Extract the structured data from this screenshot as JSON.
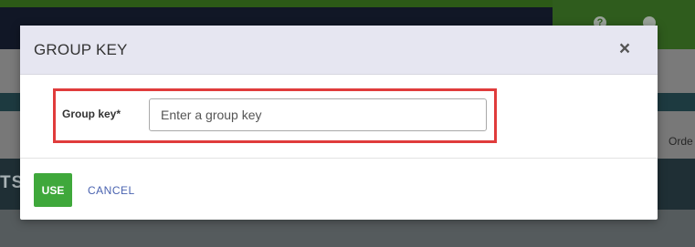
{
  "background": {
    "right_text": "Orde",
    "left_text": "TS"
  },
  "modal": {
    "title": "GROUP KEY",
    "close_icon": "close-icon",
    "close_glyph": "×",
    "field": {
      "label": "Group key*",
      "value": "",
      "placeholder": "Enter a group key"
    },
    "buttons": {
      "use": "USE",
      "cancel": "CANCEL"
    }
  },
  "colors": {
    "primary_button": "#3fa83b",
    "link": "#4a63b0",
    "highlight": "#e03c3c",
    "header_bg": "#e6e6f1"
  }
}
